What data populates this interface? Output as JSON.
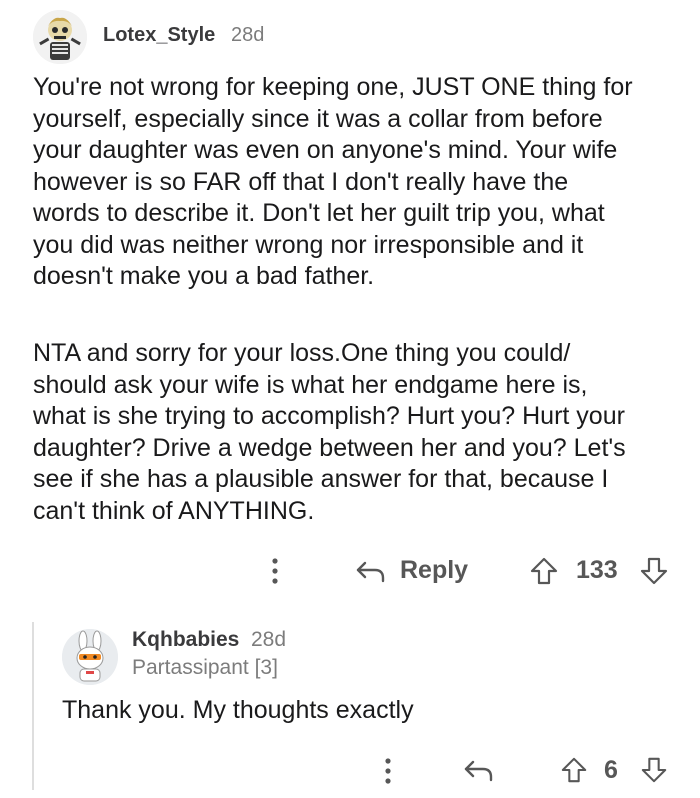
{
  "comment": {
    "username": "Lotex_Style",
    "time": "28d",
    "avatar_icon": "skeleton-avatar-icon",
    "paragraphs": [
      "You're not wrong for keeping one, JUST ONE thing for\nyourself, especially since it was a collar from before\nyour daughter was even on anyone's mind. Your wife\nhowever is so FAR off that I don't really have the\nwords to describe it. Don't let her guilt trip you, what\nyou did was neither wrong nor irresponsible and it\ndoesn't make you a bad father.",
      "NTA and sorry for your loss.One thing you could/\nshould ask your wife is what her endgame here is,\nwhat is she trying to accomplish? Hurt you? Hurt your\ndaughter? Drive a wedge between her and you? Let's\nsee if she has a plausible answer for that, because I\ncan't think of ANYTHING."
    ],
    "actions": {
      "reply_label": "Reply",
      "score": "133"
    }
  },
  "reply": {
    "username": "Kqhbabies",
    "time": "28d",
    "flair": "Partassipant [3]",
    "avatar_icon": "bunny-avatar-icon",
    "text": "Thank you. My thoughts exactly",
    "actions": {
      "score": "6"
    }
  }
}
